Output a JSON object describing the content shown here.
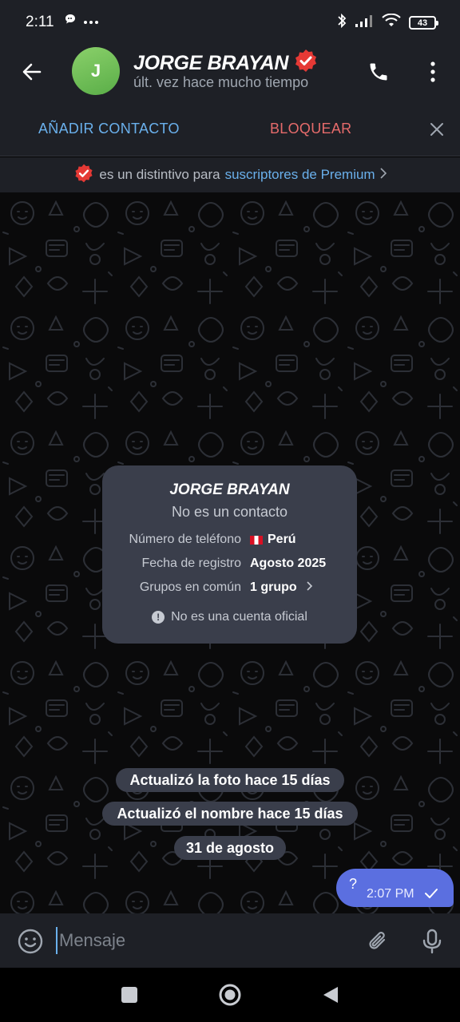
{
  "status_bar": {
    "time": "2:11",
    "left_icons": [
      "chat-bubble-icon",
      "more-dots-icon"
    ],
    "right_icons": [
      "bluetooth-icon",
      "signal-icon",
      "wifi-icon"
    ],
    "battery": "43"
  },
  "header": {
    "name": "JORGE BRAYAN",
    "avatar_initial": "J",
    "last_seen": "últ. vez hace mucho tiempo",
    "verified_badge": "premium-badge-icon",
    "accent_color": "#6ab0ec"
  },
  "action_bar": {
    "add_contact": "AÑADIR CONTACTO",
    "block": "BLOQUEAR"
  },
  "premium_notice": {
    "text": "es un distintivo para",
    "link": "suscriptores de Premium"
  },
  "info_card": {
    "title": "JORGE BRAYAN",
    "subtitle": "No es un contacto",
    "rows": [
      {
        "label": "Número de teléfono",
        "value": "Perú"
      },
      {
        "label": "Fecha de registro",
        "value": "Agosto 2025"
      },
      {
        "label": "Grupos en común",
        "value": "1 grupo"
      }
    ],
    "note": "No es una cuenta oficial"
  },
  "service_messages": [
    "Actualizó la foto hace 15 días",
    "Actualizó el nombre hace 15 días",
    "31 de agosto"
  ],
  "outgoing_message": {
    "text": "?",
    "time": "2:07 PM",
    "bubble_color": "#5b6fe0"
  },
  "input": {
    "placeholder": "Mensaje"
  }
}
